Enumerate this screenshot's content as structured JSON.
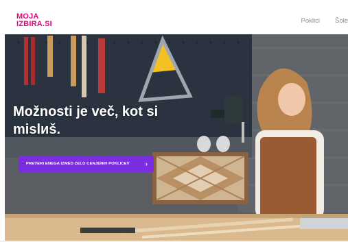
{
  "header": {
    "logo_line1": "MOJA",
    "logo_line2": "IZBIRA.SI",
    "nav": [
      "Poklici",
      "Šole"
    ]
  },
  "hero": {
    "title": "Možnosti je več, kot si mislиš.",
    "cta_label": "PREVERI ENEGA IZMED ZELO CENJENIH POKLICEV",
    "cta_icon": "chevron-right-icon"
  },
  "colors": {
    "brand": "#e6007e",
    "cta": "#7b2ee0",
    "nav_text": "#8c8c8c"
  }
}
